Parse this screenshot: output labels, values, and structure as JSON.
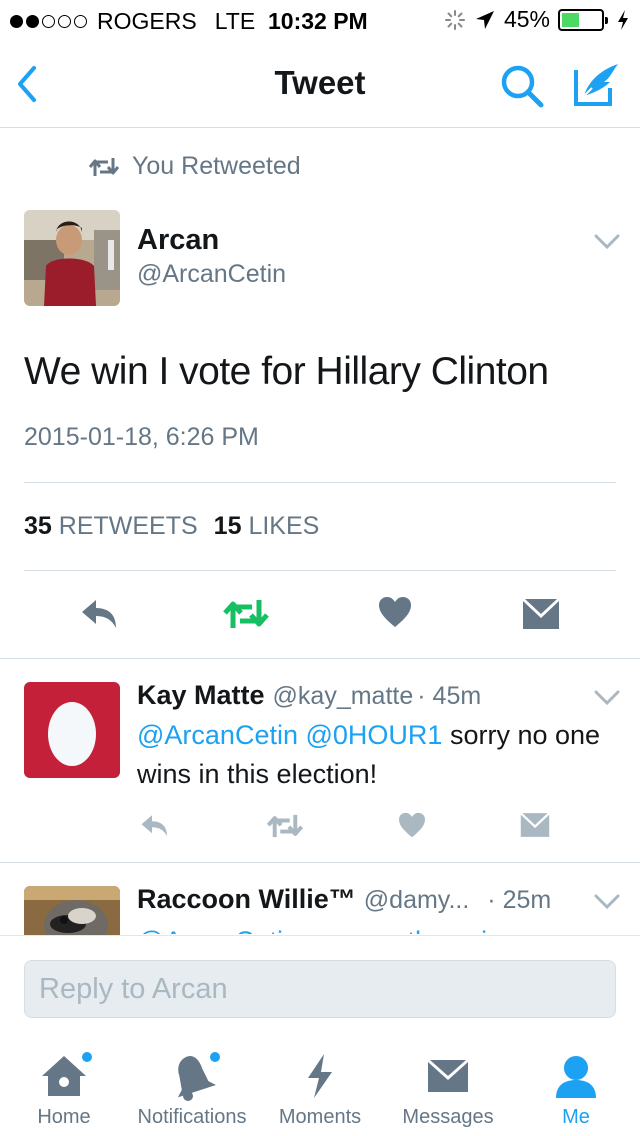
{
  "status_bar": {
    "carrier": "ROGERS",
    "network": "LTE",
    "time": "10:32 PM",
    "battery_percent": "45%",
    "battery_level": 0.45,
    "signal_bars_filled": 2,
    "signal_bars_total": 5
  },
  "nav": {
    "title": "Tweet",
    "back_icon": "chevron-left-icon",
    "search_icon": "search-icon",
    "compose_icon": "compose-icon"
  },
  "main_tweet": {
    "retweet_note": "You Retweeted",
    "author_name": "Arcan",
    "author_handle": "@ArcanCetin",
    "text": "We win I vote for Hillary Clinton",
    "timestamp": "2015-01-18, 6:26 PM",
    "retweets_count": "35",
    "retweets_label": "RETWEETS",
    "likes_count": "15",
    "likes_label": "LIKES"
  },
  "replies": [
    {
      "name": "Kay Matte",
      "handle": "@kay_matte",
      "time": "· 45m",
      "mention1": "@ArcanCetin",
      "mention2": "@0HOUR1",
      "text_rest": "sorry no one wins in this election!"
    },
    {
      "name": "Raccoon Willie™",
      "handle": "@damy...",
      "time": "· 25m",
      "partial_text": "@ArcanCetin  can you throw in a"
    }
  ],
  "composer": {
    "placeholder": "Reply to Arcan"
  },
  "tabs": [
    {
      "label": "Home",
      "icon": "home-icon",
      "badge": true,
      "active": false
    },
    {
      "label": "Notifications",
      "icon": "bell-icon",
      "badge": true,
      "active": false
    },
    {
      "label": "Moments",
      "icon": "lightning-icon",
      "badge": false,
      "active": false
    },
    {
      "label": "Messages",
      "icon": "envelope-icon",
      "badge": false,
      "active": false
    },
    {
      "label": "Me",
      "icon": "person-icon",
      "badge": false,
      "active": true
    }
  ],
  "colors": {
    "accent": "#1da1f2",
    "retweet_green": "#17bf63",
    "muted": "#657786",
    "divider": "#d6dde2",
    "egg_red": "#c4203a"
  }
}
